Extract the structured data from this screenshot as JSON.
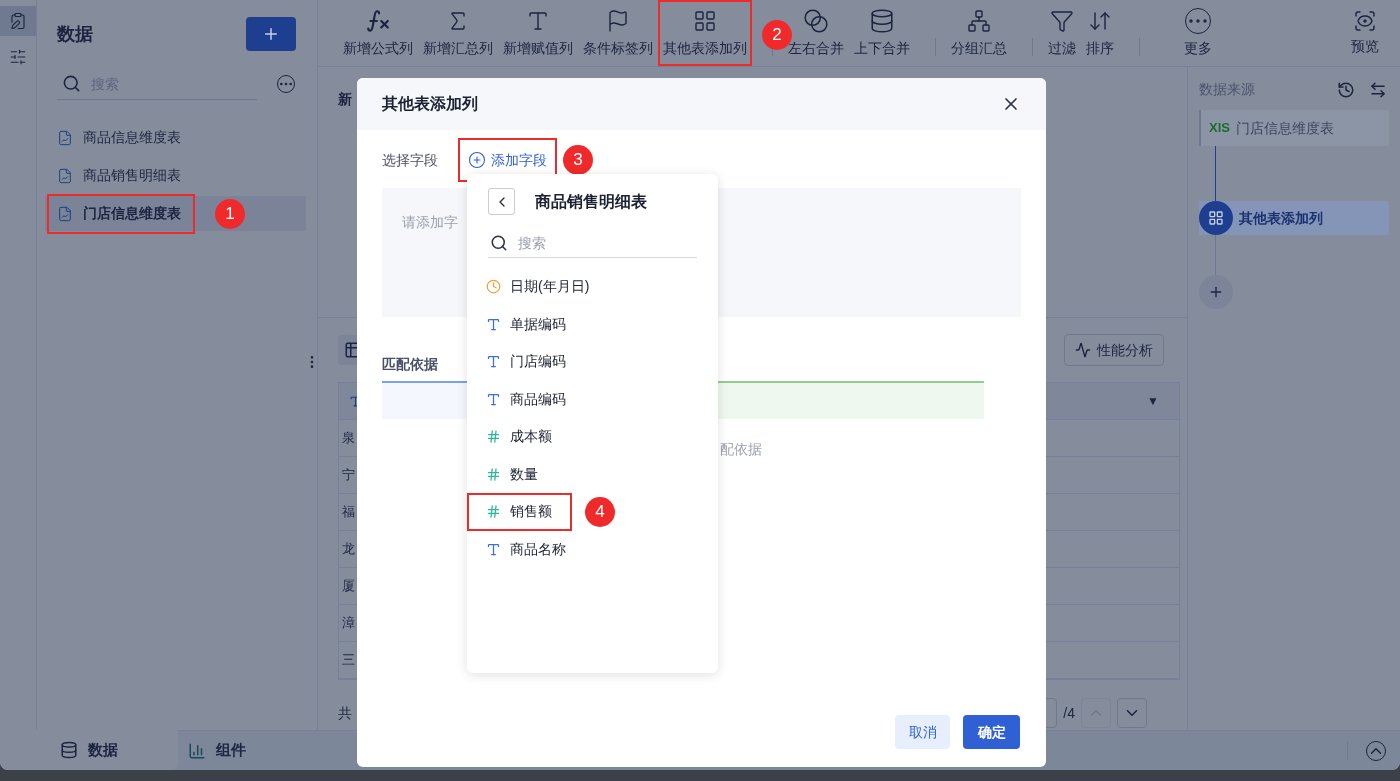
{
  "rail": {
    "items": [
      {
        "selected": true
      },
      {
        "selected": false
      }
    ]
  },
  "sidebar": {
    "title": "数据",
    "search": {
      "placeholder": "搜索"
    },
    "items": [
      {
        "label": "商品信息维度表",
        "selected": false,
        "highlighted": false
      },
      {
        "label": "商品销售明细表",
        "selected": false,
        "highlighted": false
      },
      {
        "label": "门店信息维度表",
        "selected": true,
        "highlighted": true,
        "badge": "1"
      }
    ]
  },
  "toolbar": {
    "groups": [
      [
        {
          "label": "新增公式列",
          "highlighted": false
        },
        {
          "label": "新增汇总列",
          "highlighted": false
        },
        {
          "label": "新增赋值列",
          "highlighted": false
        },
        {
          "label": "条件标签列",
          "highlighted": false
        },
        {
          "label": "其他表添加列",
          "highlighted": true,
          "badge": "2"
        }
      ],
      [
        {
          "label": "左右合并",
          "highlighted": false
        },
        {
          "label": "上下合并",
          "highlighted": false
        }
      ],
      [
        {
          "label": "分组汇总",
          "highlighted": false
        }
      ],
      [
        {
          "label": "过滤",
          "highlighted": false
        },
        {
          "label": "排序",
          "highlighted": false
        }
      ],
      [
        {
          "label": "更多",
          "highlighted": false
        }
      ]
    ],
    "preview": {
      "label": "预览"
    }
  },
  "content": {
    "title": "新",
    "analysis_button": "性能分析",
    "table": {
      "header_marker": "▼",
      "rows": [
        "泉",
        "宁",
        "福",
        "龙",
        "厦",
        "漳",
        "三"
      ]
    },
    "pagination": {
      "total": "共",
      "pages": "/4",
      "prev_disabled": true
    }
  },
  "data_source": {
    "title": "数据来源",
    "nodes": [
      {
        "kind": "source",
        "file_type": "XlS",
        "label": "门店信息维度表",
        "selected": false
      },
      {
        "kind": "step",
        "label": "其他表添加列",
        "selected": true
      }
    ]
  },
  "bottom_tabs": [
    {
      "label": "数据",
      "selected": true
    },
    {
      "label": "组件",
      "selected": false
    }
  ],
  "dialog": {
    "title": "其他表添加列",
    "field_label": "选择字段",
    "add_field": {
      "label": "添加字段",
      "highlighted": true,
      "badge": "3"
    },
    "field_placeholder": "请添加字",
    "match_tab": "匹配依据",
    "match_hint": "配依据",
    "cancel": "取消",
    "confirm": "确定"
  },
  "field_picker": {
    "title": "商品销售明细表",
    "search": {
      "placeholder": "搜索"
    },
    "fields": [
      {
        "kind": "date",
        "label": "日期(年月日)",
        "highlighted": false
      },
      {
        "kind": "text",
        "label": "单据编码",
        "highlighted": false
      },
      {
        "kind": "text",
        "label": "门店编码",
        "highlighted": false
      },
      {
        "kind": "text",
        "label": "商品编码",
        "highlighted": false
      },
      {
        "kind": "number",
        "label": "成本额",
        "highlighted": false
      },
      {
        "kind": "number",
        "label": "数量",
        "highlighted": false
      },
      {
        "kind": "number",
        "label": "销售额",
        "highlighted": true,
        "badge": "4"
      },
      {
        "kind": "text",
        "label": "商品名称",
        "highlighted": false
      }
    ]
  }
}
